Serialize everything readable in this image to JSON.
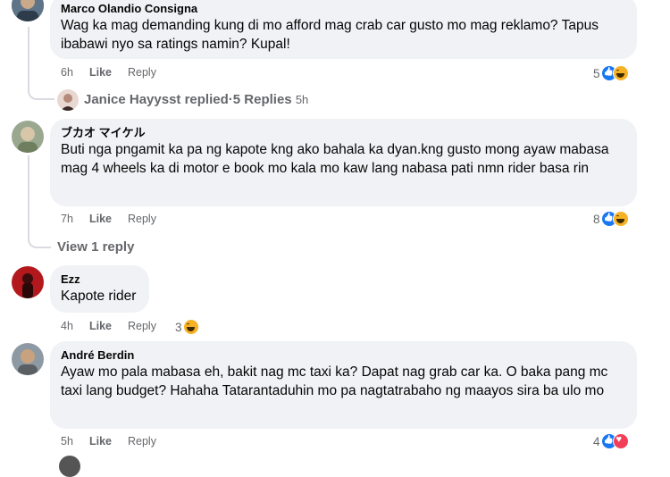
{
  "comments": [
    {
      "author": "Marco Olandio Consigna",
      "text": "Wag ka mag demanding kung di mo afford mag crab car gusto mo mag reklamo? Tapus ibabawi nyo sa ratings namin? Kupal!",
      "age": "6h",
      "like": "Like",
      "reply": "Reply",
      "reaction_count": "5"
    },
    {
      "author": "ブカオ マイケル",
      "text": "Buti nga pngamit ka pa ng kapote kng ako bahala ka dyan.kng gusto mong ayaw mabasa mag 4 wheels ka di motor e book mo kala mo kaw lang nabasa pati nmn rider basa rin",
      "age": "7h",
      "like": "Like",
      "reply": "Reply",
      "reaction_count": "8"
    },
    {
      "author": "Ezz",
      "text": "Kapote rider",
      "age": "4h",
      "like": "Like",
      "reply": "Reply",
      "reaction_count": "3"
    },
    {
      "author": "André Berdin",
      "text": "Ayaw mo pala mabasa eh, bakit nag mc taxi ka? Dapat nag grab car ka. O baka pang mc taxi lang budget? Hahaha Tatarantaduhin mo pa nagtatrabaho ng maayos sira ba ulo mo",
      "age": "5h",
      "like": "Like",
      "reply": "Reply",
      "reaction_count": "4"
    }
  ],
  "replies_summary": {
    "name": "Janice Hayysst",
    "replied": "replied",
    "sep": " · ",
    "count": "5 Replies",
    "age": "5h"
  },
  "view_reply": "View 1 reply",
  "colors": {
    "bubble": "#f0f2f5",
    "muted": "#65676b",
    "like_blue": "#1877f2",
    "haha_yellow": "#f7b125",
    "love_red": "#f33e58"
  }
}
